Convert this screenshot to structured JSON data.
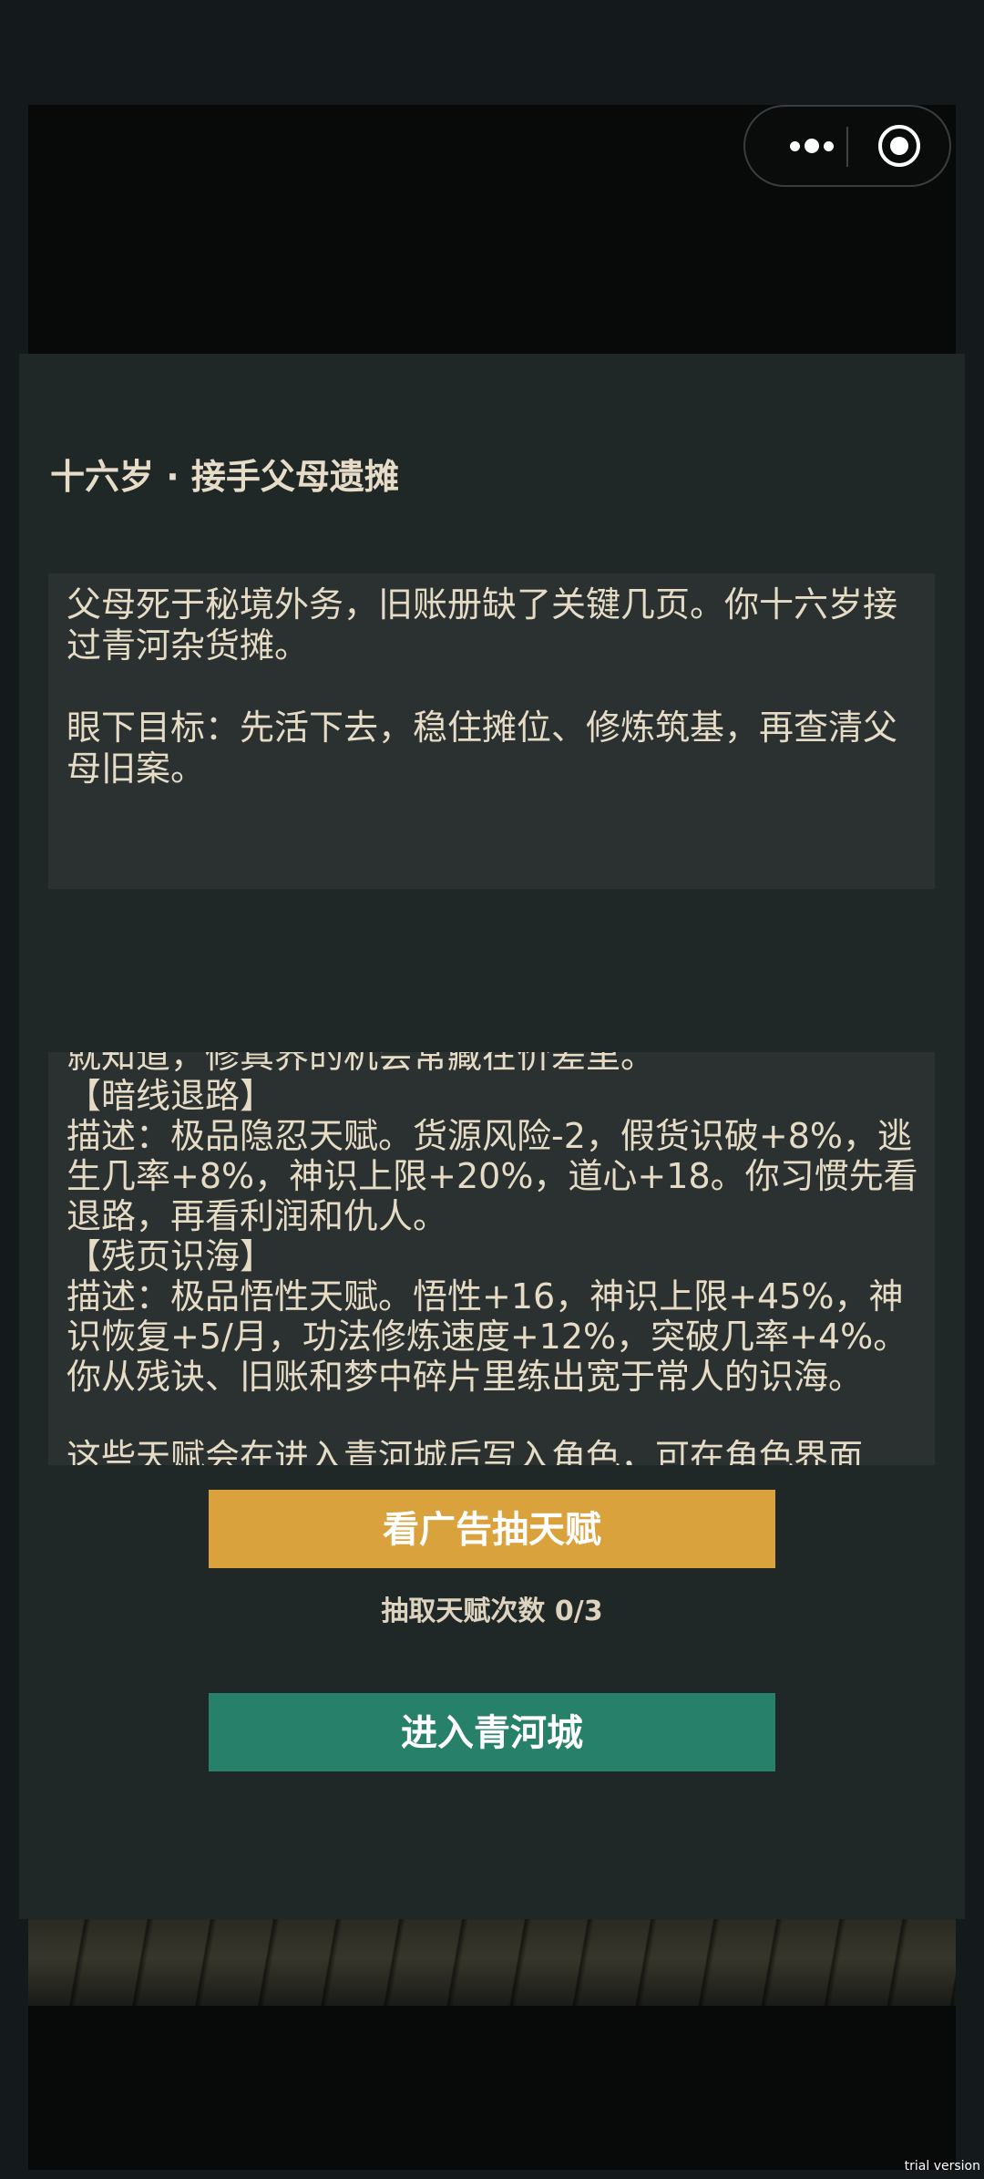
{
  "header": {
    "more_icon": "more-dots-icon",
    "close_icon": "target-circle-icon"
  },
  "panel": {
    "title": "十六岁 · 接手父母遗摊",
    "story": "父母死于秘境外务，旧账册缺了关键几页。你十六岁接过青河杂货摊。\n\n眼下目标：先活下去，稳住摊位、修炼筑基，再查清父母旧案。",
    "talents_text": "就知道，修真界的机会常藏在价差里。\n【暗线退路】\n描述：极品隐忍天赋。货源风险-2，假货识破+8%，逃生几率+8%，神识上限+20%，道心+18。你习惯先看退路，再看利润和仇人。\n【残页识海】\n描述：极品悟性天赋。悟性+16，神识上限+45%，神识恢复+5/月，功法修炼速度+12%，突破几率+4%。你从残诀、旧账和梦中碎片里练出宽于常人的识海。\n\n这些天赋会在进入青河城后写入角色，可在角色界面"
  },
  "actions": {
    "ad_draw_label": "看广告抽天赋",
    "draw_count_label": "抽取天赋次数 0/3",
    "enter_label": "进入青河城"
  },
  "watermark": "trial version",
  "colors": {
    "ad_button": "#d9a23d",
    "enter_button": "#27806a",
    "text": "#e6dcc6"
  }
}
